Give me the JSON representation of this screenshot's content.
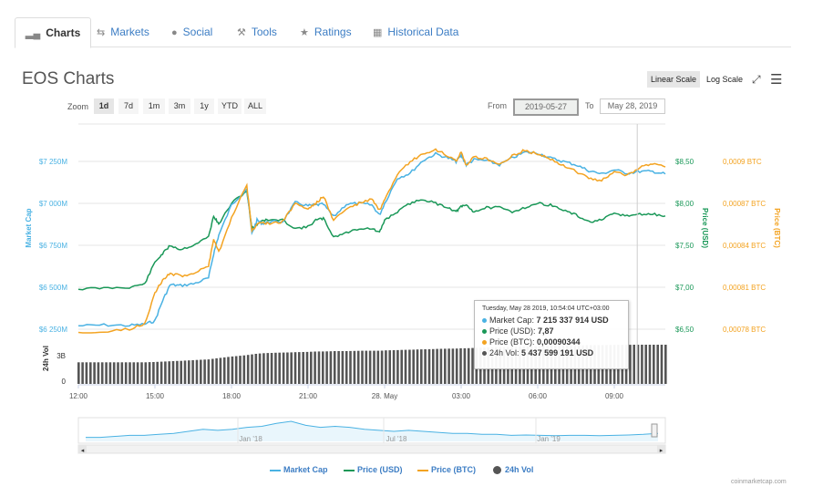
{
  "tabs": [
    {
      "label": "Charts",
      "icon": "bar-chart-icon"
    },
    {
      "label": "Markets",
      "icon": "exchange-arrows-icon"
    },
    {
      "label": "Social",
      "icon": "globe-icon"
    },
    {
      "label": "Tools",
      "icon": "wrench-icon"
    },
    {
      "label": "Ratings",
      "icon": "star-icon"
    },
    {
      "label": "Historical Data",
      "icon": "calendar-icon"
    }
  ],
  "header": {
    "title": "EOS Charts",
    "linear_scale": "Linear Scale",
    "log_scale": "Log Scale"
  },
  "zoom": {
    "label": "Zoom",
    "buttons": [
      "1d",
      "7d",
      "1m",
      "3m",
      "1y",
      "YTD",
      "ALL"
    ],
    "selected": "1d"
  },
  "range": {
    "from_label": "From",
    "from_value": "2019-05-27",
    "to_label": "To",
    "to_value": "May 28, 2019"
  },
  "colors": {
    "market_cap": "#4ab2e3",
    "price_usd": "#1a9858",
    "price_btc": "#f3a321",
    "volume": "#555555"
  },
  "chart_data": {
    "type": "line",
    "x_ticks": [
      "12:00",
      "15:00",
      "18:00",
      "21:00",
      "28. May",
      "03:00",
      "06:00",
      "09:00"
    ],
    "yaxis_left": {
      "label": "Market Cap",
      "ticks": [
        "$7 250M",
        "$7 000M",
        "$6 750M",
        "$6 500M",
        "$6 250M"
      ],
      "ylim": [
        6200,
        7450
      ]
    },
    "yaxis_right_usd": {
      "label": "Price (USD)",
      "ticks": [
        "$8,50",
        "$8,00",
        "$7,50",
        "$7,00",
        "$6,50"
      ],
      "ylim": [
        6.4,
        8.9
      ]
    },
    "yaxis_right_btc": {
      "label": "Price (BTC)",
      "ticks": [
        "0,0009 BTC",
        "0,00087 BTC",
        "0,00084 BTC",
        "0,00081 BTC",
        "0,00078 BTC"
      ],
      "ylim": [
        0.00077,
        0.00092
      ]
    },
    "volume_axis": {
      "label": "24h Vol",
      "ticks": [
        "3B",
        "0"
      ]
    },
    "x_hours": [
      0,
      1,
      2,
      2.6,
      3,
      3.3,
      3.6,
      4,
      4.5,
      5.1,
      5.3,
      5.5,
      6,
      6.6,
      6.8,
      7,
      7.2,
      7.5,
      8,
      8.5,
      9,
      9.3,
      9.6,
      10,
      10.5,
      11,
      11.5,
      11.8,
      12,
      12.5,
      13,
      13.5,
      14,
      14.5,
      14.8,
      15,
      15.2,
      15.5,
      16,
      16.5,
      17,
      17.5,
      18,
      18.5,
      19,
      19.5,
      20,
      20.5,
      21,
      21.5,
      22,
      22.5,
      23
    ],
    "series": [
      {
        "name": "Market Cap",
        "unit": "M USD",
        "values": [
          6270,
          6275,
          6272,
          6280,
          6300,
          6420,
          6515,
          6510,
          6520,
          6555,
          6700,
          6810,
          6990,
          7090,
          6820,
          6900,
          6880,
          6890,
          6890,
          7005,
          6985,
          6990,
          6995,
          6920,
          6995,
          7000,
          6990,
          6930,
          7000,
          7150,
          7180,
          7255,
          7295,
          7270,
          7250,
          7285,
          7230,
          7260,
          7255,
          7230,
          7270,
          7305,
          7300,
          7270,
          7250,
          7230,
          7195,
          7175,
          7200,
          7180,
          7190,
          7190,
          7175
        ]
      },
      {
        "name": "Price (USD)",
        "unit": "USD",
        "values": [
          6.98,
          6.99,
          7.0,
          7.04,
          7.3,
          7.4,
          7.5,
          7.45,
          7.5,
          7.6,
          7.85,
          7.75,
          8.0,
          8.15,
          7.7,
          7.75,
          7.8,
          7.8,
          7.8,
          7.7,
          7.72,
          7.8,
          7.82,
          7.6,
          7.65,
          7.7,
          7.7,
          7.65,
          7.8,
          7.9,
          8.0,
          8.05,
          8.0,
          7.95,
          7.9,
          7.96,
          7.98,
          7.9,
          7.95,
          7.95,
          7.9,
          7.95,
          8.0,
          7.98,
          7.92,
          7.86,
          7.78,
          7.8,
          7.88,
          7.85,
          7.87,
          7.87,
          7.85
        ]
      },
      {
        "name": "Price (BTC)",
        "unit": "BTC",
        "values": [
          0.000777,
          0.000778,
          0.00078,
          0.000784,
          0.000806,
          0.000815,
          0.00082,
          0.000818,
          0.00082,
          0.000825,
          0.000845,
          0.000835,
          0.00086,
          0.000883,
          0.00085,
          0.000855,
          0.000857,
          0.000855,
          0.000857,
          0.00087,
          0.000866,
          0.00087,
          0.000875,
          0.000858,
          0.000866,
          0.00087,
          0.000873,
          0.000865,
          0.000872,
          0.00089,
          0.0009,
          0.000905,
          0.000908,
          0.000904,
          0.0009,
          0.000907,
          0.000897,
          0.000903,
          0.000902,
          0.000898,
          0.000904,
          0.000908,
          0.000905,
          0.000902,
          0.000897,
          0.000893,
          0.000888,
          0.000886,
          0.000893,
          0.00089,
          0.000896,
          0.000898,
          0.000896
        ]
      },
      {
        "name": "24h Vol",
        "unit": "USD",
        "values": [
          3000000000.0,
          3000000000.0,
          3000000000.0,
          3000000000.0,
          3050000000.0,
          3100000000.0,
          3150000000.0,
          3200000000.0,
          3300000000.0,
          3400000000.0,
          3500000000.0,
          3600000000.0,
          3800000000.0,
          4000000000.0,
          4100000000.0,
          4200000000.0,
          4250000000.0,
          4300000000.0,
          4350000000.0,
          4400000000.0,
          4450000000.0,
          4500000000.0,
          4500000000.0,
          4550000000.0,
          4550000000.0,
          4600000000.0,
          4600000000.0,
          4600000000.0,
          4650000000.0,
          4700000000.0,
          4750000000.0,
          4800000000.0,
          4850000000.0,
          4900000000.0,
          4900000000.0,
          4950000000.0,
          4950000000.0,
          5000000000.0,
          5050000000.0,
          5100000000.0,
          5150000000.0,
          5200000000.0,
          5250000000.0,
          5300000000.0,
          5330000000.0,
          5360000000.0,
          5380000000.0,
          5400000000.0,
          5420000000.0,
          5430000000.0,
          5440000000.0,
          5440000000.0,
          5440000000.0
        ]
      }
    ],
    "navigator_ticks": [
      "Jan '18",
      "Jul '18",
      "Jan '19"
    ],
    "legend": [
      "Market Cap",
      "Price (USD)",
      "Price (BTC)",
      "24h Vol"
    ],
    "legend_placement": "bottom",
    "grid": true
  },
  "tooltip": {
    "header": "Tuesday, May 28 2019, 10:54:04 UTC+03:00",
    "rows": [
      {
        "label": "Market Cap:",
        "value": "7 215 337 914 USD"
      },
      {
        "label": "Price (USD):",
        "value": "7,87"
      },
      {
        "label": "Price (BTC):",
        "value": "0,00090344"
      },
      {
        "label": "24h Vol:",
        "value": "5 437 599 191 USD"
      }
    ]
  },
  "credit": "coinmarketcap.com"
}
